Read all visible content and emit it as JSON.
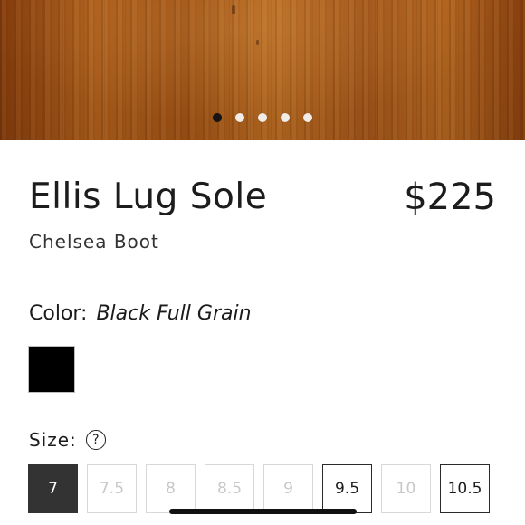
{
  "gallery": {
    "slide_count": 5,
    "active_slide": 1
  },
  "product": {
    "name": "Ellis Lug Sole",
    "price": "$225",
    "subtitle": "Chelsea Boot"
  },
  "color": {
    "label": "Color:",
    "selected_name": "Black Full Grain",
    "swatches": [
      {
        "name": "black-full-grain",
        "hex": "#000000"
      }
    ]
  },
  "size": {
    "label": "Size:",
    "help_icon": "question-circle-icon",
    "help_glyph": "?",
    "options": [
      {
        "label": "7",
        "state": "selected"
      },
      {
        "label": "7.5",
        "state": "unavailable"
      },
      {
        "label": "8",
        "state": "unavailable"
      },
      {
        "label": "8.5",
        "state": "unavailable"
      },
      {
        "label": "9",
        "state": "unavailable"
      },
      {
        "label": "9.5",
        "state": "available"
      },
      {
        "label": "10",
        "state": "unavailable"
      },
      {
        "label": "10.5",
        "state": "available"
      }
    ]
  },
  "colors": {
    "selected_size_bg": "#333333",
    "text": "#1c1c1c",
    "unavailable_text": "#c8c8c8"
  }
}
